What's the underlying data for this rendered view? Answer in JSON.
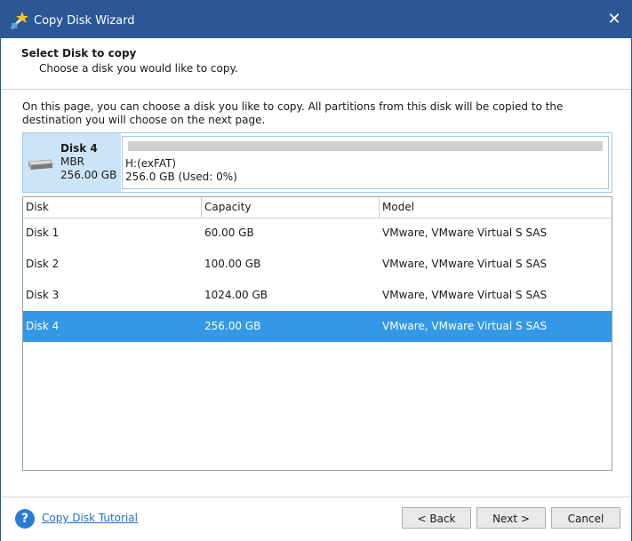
{
  "window": {
    "title": "Copy Disk Wizard"
  },
  "header": {
    "title": "Select Disk to copy",
    "subtitle": "Choose a disk you would like to copy."
  },
  "description": "On this page, you can choose a disk you like to copy. All partitions from this disk will be copied to the destination you will choose on the next page.",
  "selected_disk": {
    "name": "Disk 4",
    "type": "MBR",
    "size": "256.00 GB",
    "partition": {
      "label": "H:(exFAT)",
      "info": "256.0 GB (Used: 0%)",
      "used_fraction": 0.0
    }
  },
  "table": {
    "columns": [
      "Disk",
      "Capacity",
      "Model"
    ],
    "rows": [
      {
        "disk": "Disk 1",
        "capacity": "60.00 GB",
        "model": "VMware, VMware Virtual S SAS",
        "selected": false
      },
      {
        "disk": "Disk 2",
        "capacity": "100.00 GB",
        "model": "VMware, VMware Virtual S SAS",
        "selected": false
      },
      {
        "disk": "Disk 3",
        "capacity": "1024.00 GB",
        "model": "VMware, VMware Virtual S SAS",
        "selected": false
      },
      {
        "disk": "Disk 4",
        "capacity": "256.00 GB",
        "model": "VMware, VMware Virtual S SAS",
        "selected": true
      }
    ]
  },
  "footer": {
    "help_link": "Copy Disk Tutorial",
    "back_label": "< Back",
    "next_label": "Next >",
    "cancel_label": "Cancel"
  },
  "colors": {
    "titlebar": "#2b5797",
    "selection": "#3399e6",
    "card_highlight": "#cce4f7"
  },
  "icons": {
    "app": "wizard-wand-icon",
    "close": "close-icon",
    "disk": "hard-disk-icon",
    "help": "help-icon"
  }
}
